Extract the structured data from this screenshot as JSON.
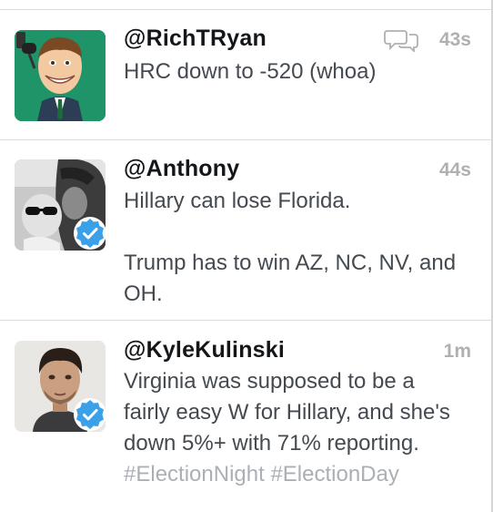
{
  "tweets": [
    {
      "handle": "@RichTRyan",
      "time": "43s",
      "text_lines": [
        "HRC down to -520 (whoa)"
      ],
      "verified": false,
      "has_reply_icon": true
    },
    {
      "handle": "@Anthony",
      "time": "44s",
      "text_lines": [
        "Hillary can lose Florida.",
        "Trump has to win AZ, NC, NV, and OH."
      ],
      "verified": true,
      "has_reply_icon": false
    },
    {
      "handle": "@KyleKulinski",
      "time": "1m",
      "text": "Virginia was supposed to be a fairly easy W for Hillary, and she's down 5%+ with 71% reporting.",
      "hashtags": [
        "#ElectionNight",
        "#ElectionDay"
      ],
      "verified": true,
      "has_reply_icon": false
    }
  ],
  "colors": {
    "handle": "#14171a",
    "text": "#444a50",
    "timestamp": "#b0b0b0",
    "hashtag": "#aab0b6",
    "verified_badge": "#3aa0e8",
    "divider": "#dcdcdc"
  }
}
